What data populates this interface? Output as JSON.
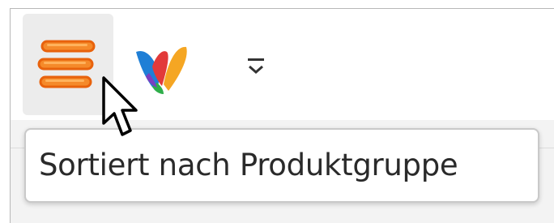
{
  "toolbar": {
    "sort_button": {
      "icon": "list-sort-icon",
      "accent": "#f47a20"
    },
    "app_logo": {
      "icon": "app-logo-icon"
    },
    "overflow_button": {
      "icon": "chevron-down-icon"
    }
  },
  "tooltip": {
    "text": "Sortiert nach Produktgruppe"
  },
  "cursor": {
    "icon": "mouse-pointer-icon"
  }
}
